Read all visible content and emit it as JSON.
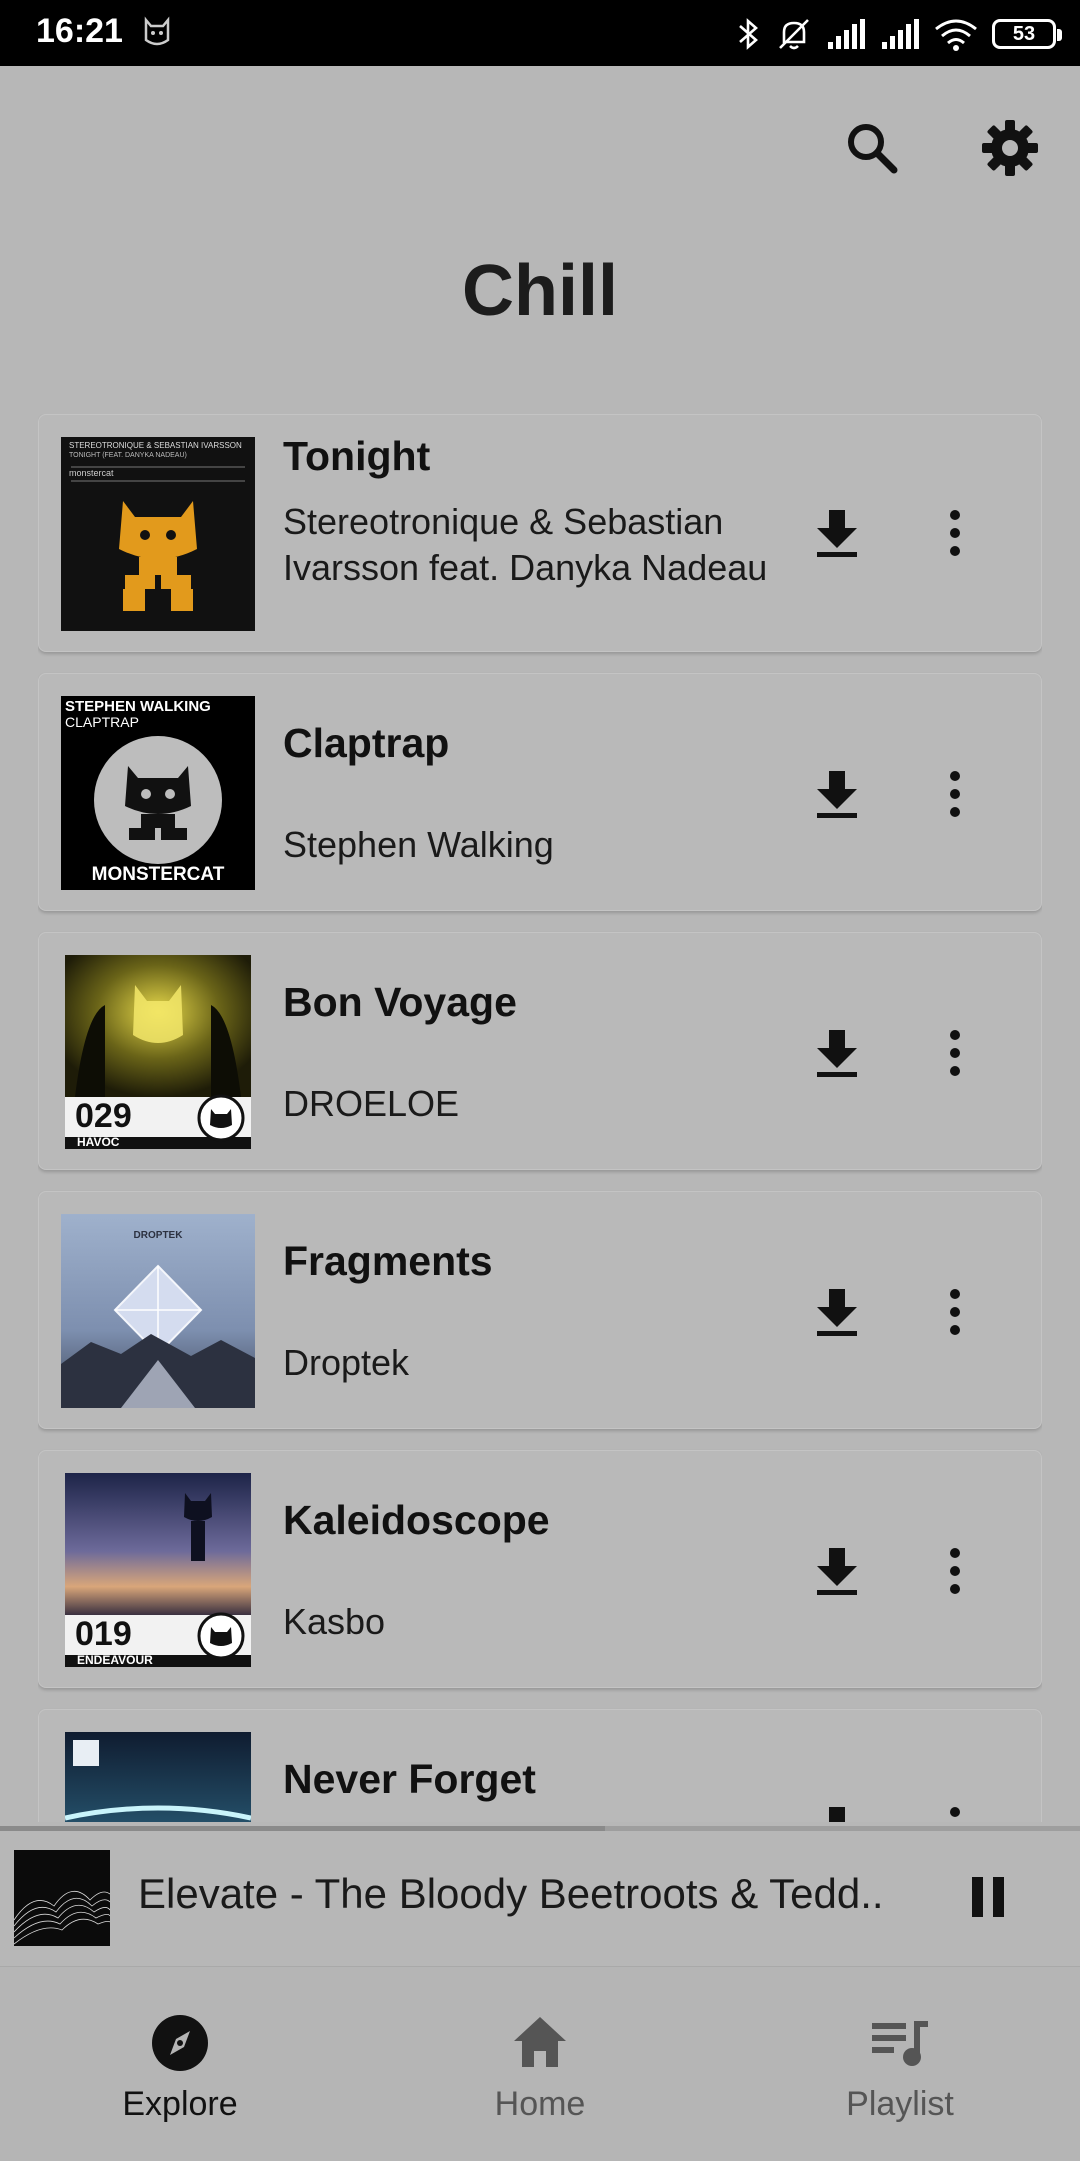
{
  "status_bar": {
    "time": "16:21",
    "battery": "53",
    "icons": [
      "cat-icon",
      "bluetooth-icon",
      "bell-off-icon",
      "signal-icon",
      "signal-icon",
      "wifi-icon",
      "battery-icon"
    ]
  },
  "header": {
    "icons": [
      "search-icon",
      "settings-icon"
    ]
  },
  "page": {
    "title": "Chill"
  },
  "songs": [
    {
      "title": "Tonight",
      "artist": "Stereotronique & Sebastian Ivarsson feat. Danyka Nadeau"
    },
    {
      "title": "Claptrap",
      "artist": "Stephen Walking"
    },
    {
      "title": "Bon Voyage",
      "artist": "DROELOE"
    },
    {
      "title": "Fragments",
      "artist": "Droptek"
    },
    {
      "title": "Kaleidoscope",
      "artist": "Kasbo"
    },
    {
      "title": "Never Forget",
      "artist": ""
    }
  ],
  "covers": {
    "tonight_header": "STEREOTRONIQUE & SEBASTIAN IVARSSON",
    "tonight_sub": "TONIGHT (FEAT. DANYKA NADEAU)",
    "tonight_label": "monstercat",
    "claptrap_artist": "STEPHEN WALKING",
    "claptrap_title": "CLAPTRAP",
    "claptrap_label": "MONSTERCAT",
    "bonvoyage_num": "029",
    "bonvoyage_name": "HAVOC",
    "fragments_label": "DROPTEK",
    "kaleidoscope_num": "019",
    "kaleidoscope_name": "ENDEAVOUR"
  },
  "now_playing": {
    "text": "Elevate  - The Bloody Beetroots & Tedd..",
    "progress": 0.56,
    "state": "playing"
  },
  "bottom_nav": {
    "items": [
      {
        "label": "Explore",
        "icon": "compass-icon",
        "active": true
      },
      {
        "label": "Home",
        "icon": "home-icon",
        "active": false
      },
      {
        "label": "Playlist",
        "icon": "playlist-icon",
        "active": false
      }
    ]
  },
  "colors": {
    "background": "#b7b7b7",
    "statusbar": "#000000",
    "active_nav": "#111111",
    "inactive_nav": "#555555"
  }
}
